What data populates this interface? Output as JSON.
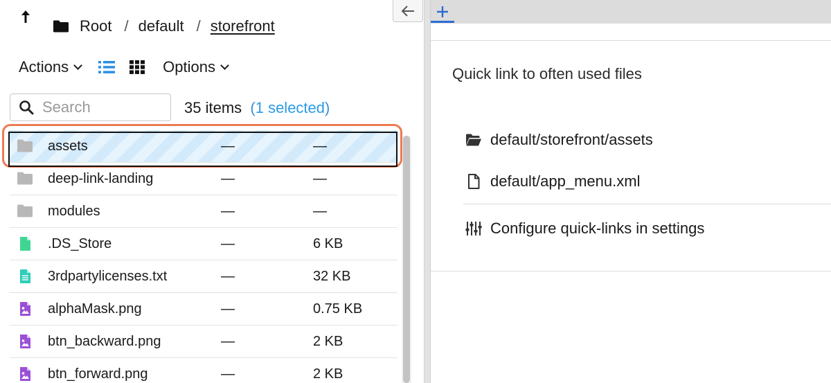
{
  "breadcrumb": {
    "items": [
      "Root",
      "default",
      "storefront"
    ],
    "separator": "/"
  },
  "toolbar": {
    "actions_label": "Actions",
    "options_label": "Options"
  },
  "search": {
    "placeholder": "Search",
    "value": ""
  },
  "status": {
    "items_count": "35 items",
    "open_paren": "(",
    "selected_text": "1 selected",
    "close_paren": ")"
  },
  "files": [
    {
      "name": "assets",
      "modified": "—",
      "size": "—",
      "type": "folder",
      "icon": "folder-icon",
      "selected": true
    },
    {
      "name": "deep-link-landing",
      "modified": "—",
      "size": "—",
      "type": "folder",
      "icon": "folder-icon"
    },
    {
      "name": "modules",
      "modified": "—",
      "size": "—",
      "type": "folder",
      "icon": "folder-icon"
    },
    {
      "name": ".DS_Store",
      "modified": "—",
      "size": "6 KB",
      "type": "file",
      "icon": "file-icon"
    },
    {
      "name": "3rdpartylicenses.txt",
      "modified": "—",
      "size": "32 KB",
      "type": "text",
      "icon": "text-file-icon"
    },
    {
      "name": "alphaMask.png",
      "modified": "—",
      "size": "0.75 KB",
      "type": "image",
      "icon": "image-file-icon"
    },
    {
      "name": "btn_backward.png",
      "modified": "—",
      "size": "2 KB",
      "type": "image",
      "icon": "image-file-icon"
    },
    {
      "name": "btn_forward.png",
      "modified": "—",
      "size": "2 KB",
      "type": "image",
      "icon": "image-file-icon"
    }
  ],
  "quicklinks": {
    "title": "Quick link to often used files",
    "items": [
      {
        "label": "default/storefront/assets",
        "icon": "folder-open-icon"
      },
      {
        "label": "default/app_menu.xml",
        "icon": "file-outline-icon"
      }
    ],
    "configure_label": "Configure quick-links in settings"
  },
  "colors": {
    "accent": "#2b6cd4",
    "selection_highlight": "#ec7b52",
    "file_green": "#3fd694",
    "text_file_teal": "#2fcdb8",
    "image_purple": "#9b4fd6",
    "folder_gray": "#b8b8b8"
  }
}
